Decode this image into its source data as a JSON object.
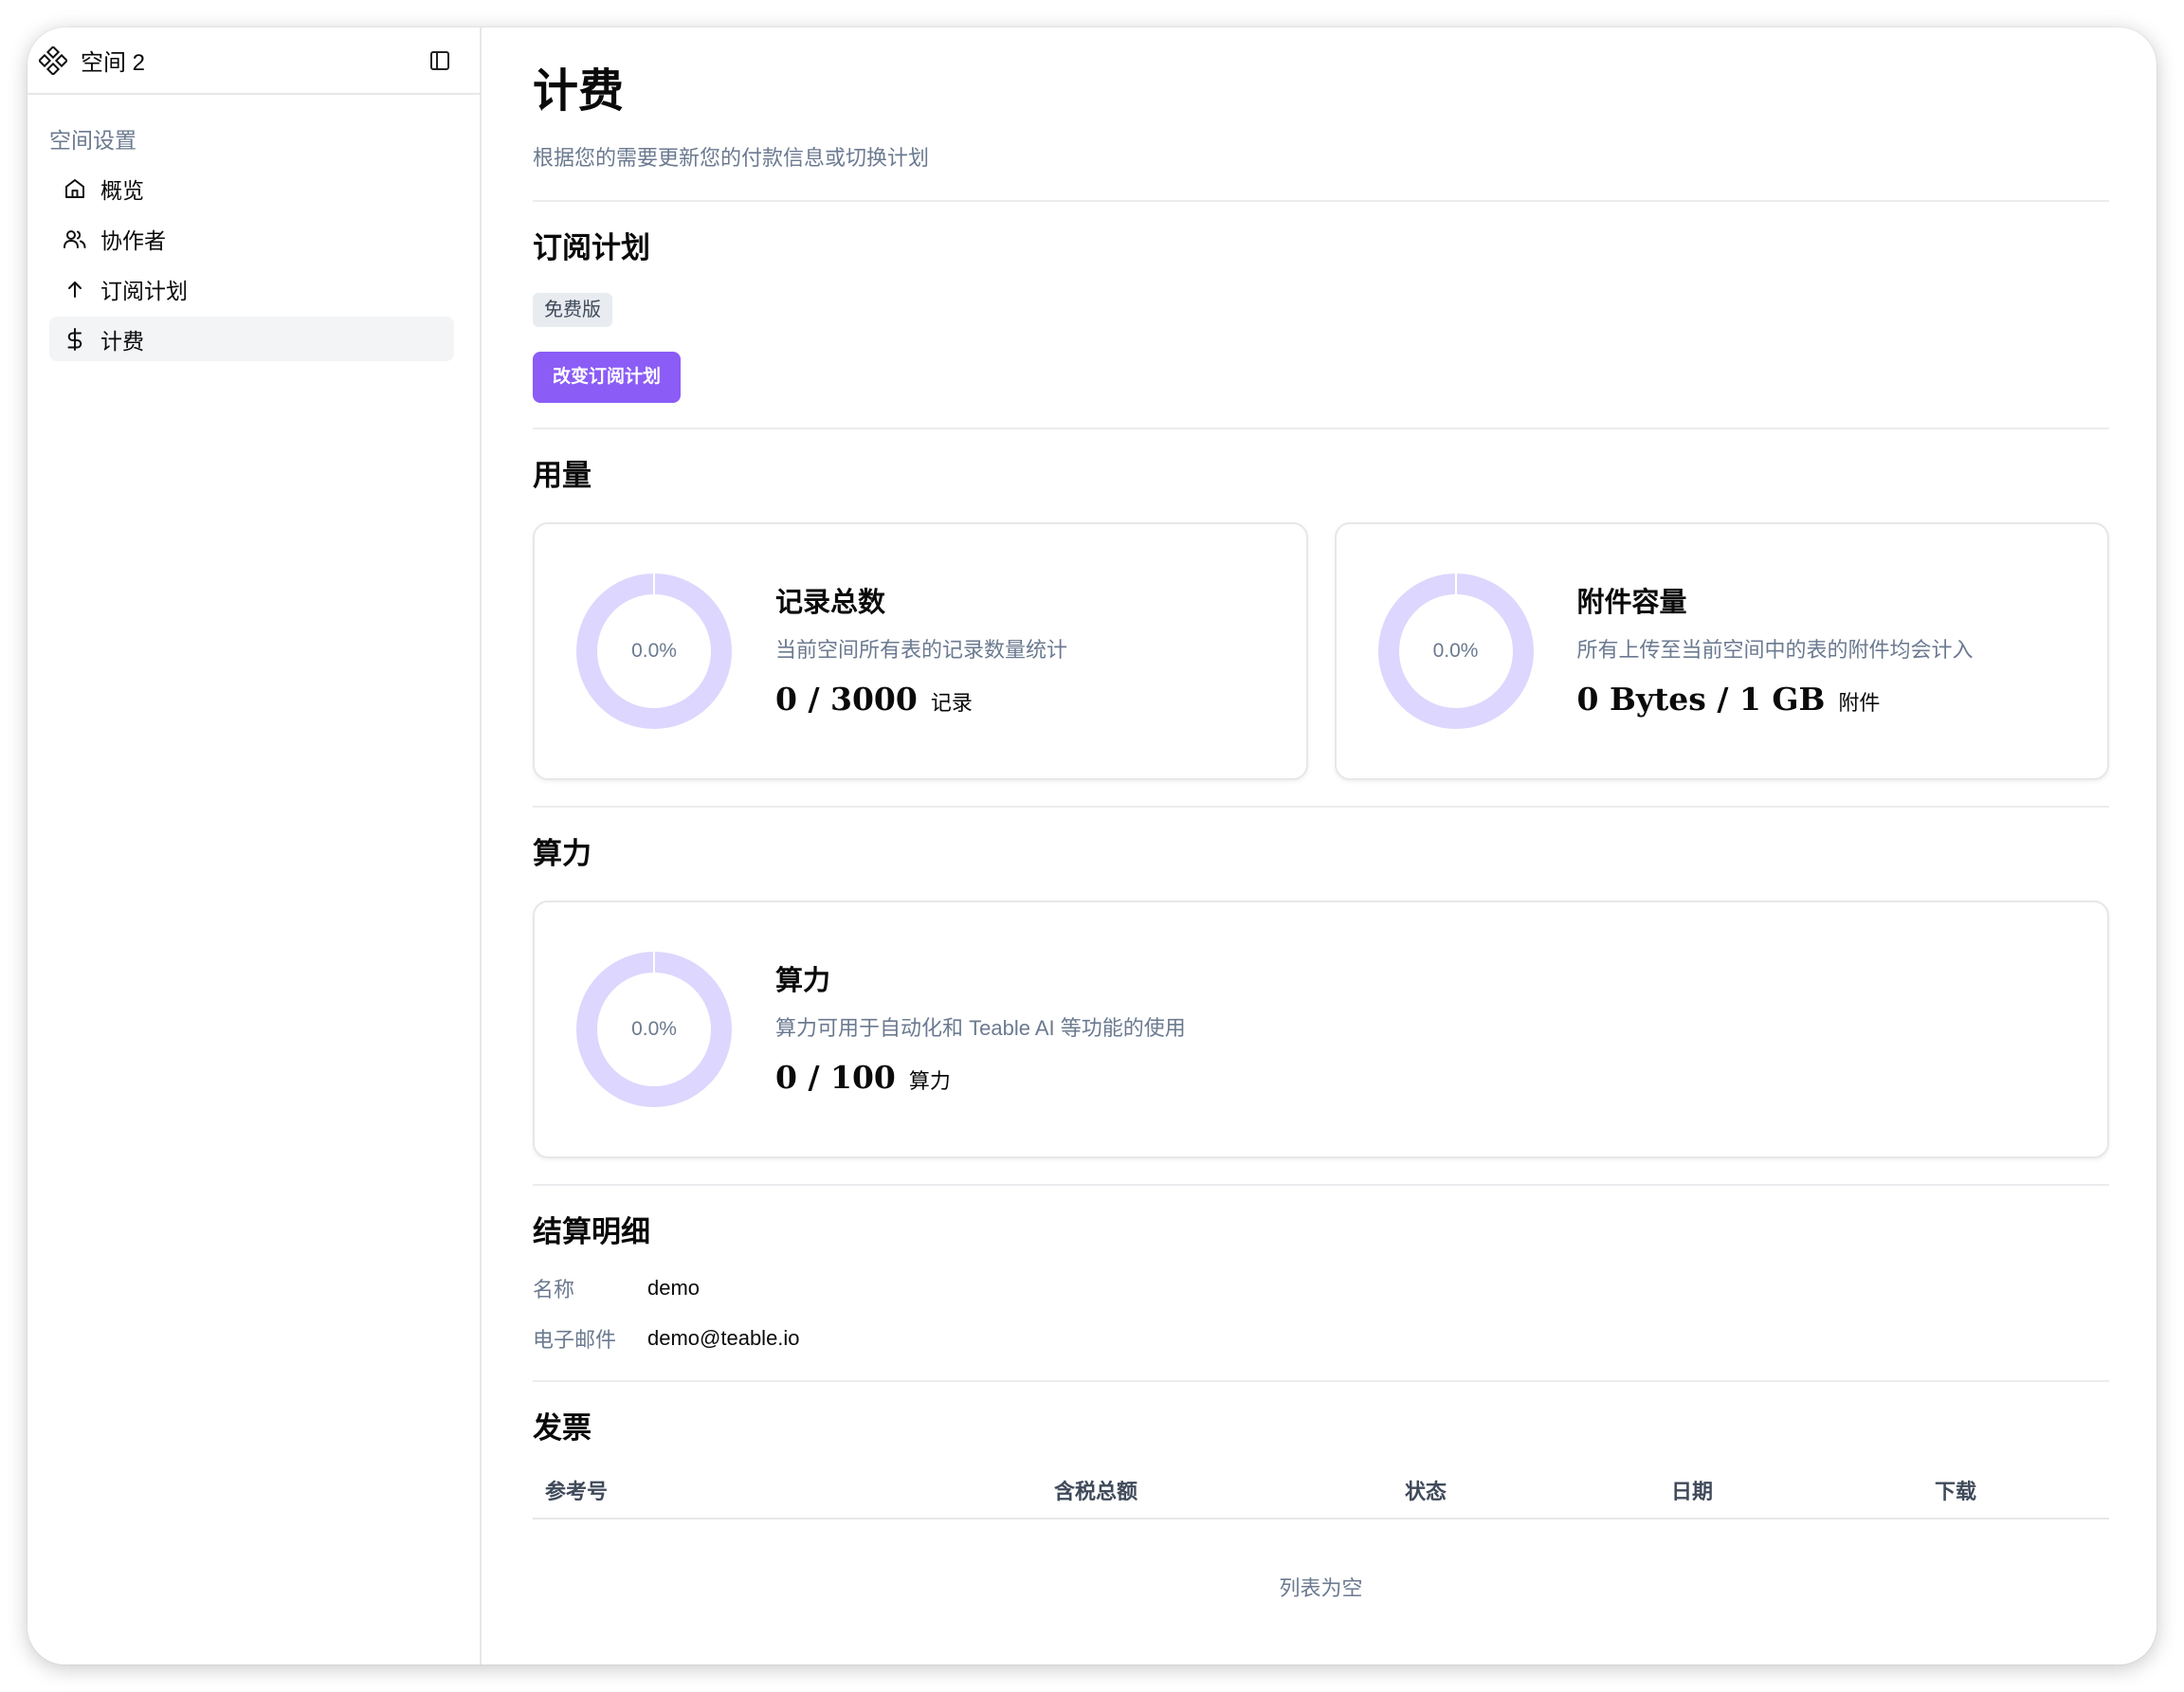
{
  "sidebar": {
    "space_name": "空间 2",
    "section_title": "空间设置",
    "items": [
      {
        "label": "概览",
        "icon": "home-icon"
      },
      {
        "label": "协作者",
        "icon": "users-icon"
      },
      {
        "label": "订阅计划",
        "icon": "arrow-up-icon"
      },
      {
        "label": "计费",
        "icon": "dollar-icon",
        "active": true
      }
    ]
  },
  "main": {
    "title": "计费",
    "subtitle": "根据您的需要更新您的付款信息或切换计划",
    "plan": {
      "heading": "订阅计划",
      "badge": "免费版",
      "change_button": "改变订阅计划"
    },
    "usage": {
      "heading": "用量",
      "cards": [
        {
          "percent_label": "0.0%",
          "percent": 0,
          "title": "记录总数",
          "description": "当前空间所有表的记录数量统计",
          "value": "0 / 3000",
          "unit": "记录"
        },
        {
          "percent_label": "0.0%",
          "percent": 0,
          "title": "附件容量",
          "description": "所有上传至当前空间中的表的附件均会计入",
          "value": "0 Bytes / 1 GB",
          "unit": "附件"
        }
      ]
    },
    "compute": {
      "heading": "算力",
      "card": {
        "percent_label": "0.0%",
        "percent": 0,
        "title": "算力",
        "description": "算力可用于自动化和 Teable AI 等功能的使用",
        "value": "0 / 100",
        "unit": "算力"
      }
    },
    "billing_details": {
      "heading": "结算明细",
      "name_label": "名称",
      "name_value": "demo",
      "email_label": "电子邮件",
      "email_value": "demo@teable.io"
    },
    "invoices": {
      "heading": "发票",
      "columns": [
        "参考号",
        "含税总额",
        "状态",
        "日期",
        "下载"
      ],
      "empty_text": "列表为空"
    }
  },
  "colors": {
    "accent": "#8b5cf6",
    "donut_track": "#ddd6fe",
    "muted_text": "#6b7a90",
    "border": "#e7e7ea"
  }
}
